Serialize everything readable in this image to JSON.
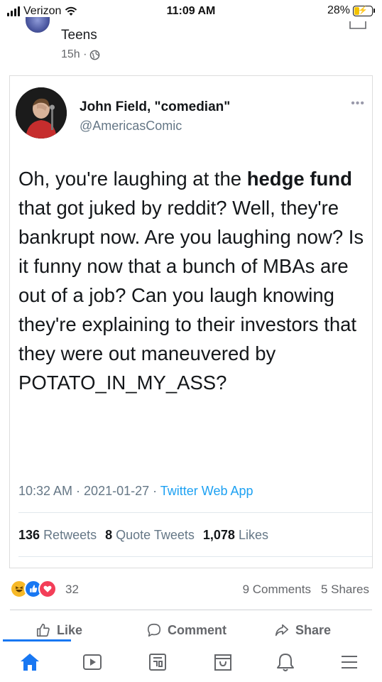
{
  "status_bar": {
    "carrier": "Verizon",
    "time": "11:09 AM",
    "battery": "28%"
  },
  "post": {
    "group_name": "Teens",
    "time": "15h ·",
    "privacy_icon": "globe-icon"
  },
  "tweet": {
    "name": "John Field, \"comedian\"",
    "handle": "@AmericasComic",
    "more": "•••",
    "body": {
      "part1": "Oh, you're laughing at the ",
      "bold1": "hedge fund",
      "part2": " that got juked by reddit? Well, they're bankrupt now. Are you laughing now? Is it funny now that a bunch of MBAs are out of a job? Can you laugh knowing they're explaining to their investors that they were out maneuvered by POTATO_IN_MY_ASS?"
    },
    "meta": {
      "timestamp": "10:32 AM · 2021-01-27 · ",
      "app": "Twitter Web App"
    },
    "stats": {
      "retweets_count": "136",
      "retweets_label": "Retweets",
      "quotes_count": "8",
      "quotes_label": "Quote Tweets",
      "likes_count": "1,078",
      "likes_label": "Likes"
    }
  },
  "reactions": {
    "count": "32",
    "comments": "9 Comments",
    "shares": "5 Shares"
  },
  "actions": {
    "like": "Like",
    "comment": "Comment",
    "share": "Share"
  },
  "nav": {
    "items": [
      "home-icon",
      "watch-icon",
      "news-icon",
      "marketplace-icon",
      "notifications-icon",
      "menu-icon"
    ]
  },
  "colors": {
    "accent": "#1877f2",
    "twitter_blue": "#1da1f2",
    "muted": "#65676b"
  }
}
